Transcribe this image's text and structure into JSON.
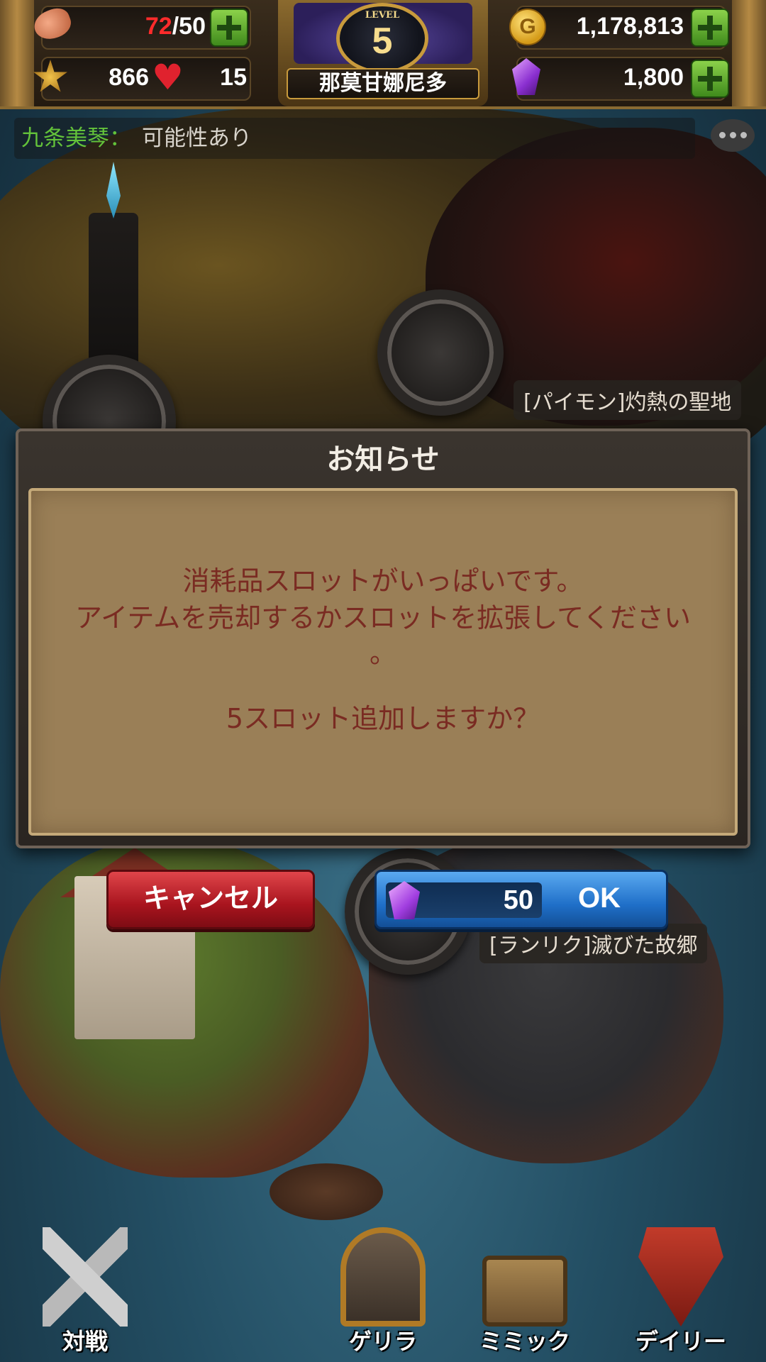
{
  "hud": {
    "stamina": {
      "current": "72",
      "separator": "/",
      "max": "50",
      "icon": "meat-icon"
    },
    "rank_points": {
      "value": "866",
      "icon": "medal-icon"
    },
    "hearts": {
      "value": "15",
      "icon": "heart-icon"
    },
    "level": {
      "word": "LEVEL",
      "number": "5"
    },
    "player_name": "那莫甘娜尼多",
    "gold": {
      "value": "1,178,813",
      "icon": "gold-coin-icon",
      "glyph": "G"
    },
    "gems": {
      "value": "1,800",
      "icon": "gem-icon"
    }
  },
  "chat": {
    "sender": "九条美琴：",
    "message": "可能性あり",
    "icon": "chat-bubble-icon"
  },
  "map": {
    "node_top": "[パイモン]灼熱の聖地",
    "node_bottom": "[ランリク]滅びた故郷"
  },
  "dialog": {
    "title": "お知らせ",
    "line1": "消耗品スロットがいっぱいです。",
    "line2": "アイテムを売却するかスロットを拡張してください",
    "line3": "。",
    "line4": "5スロット追加しますか？",
    "cancel_label": "キャンセル",
    "ok_label": "OK",
    "ok_cost": "50"
  },
  "nav": {
    "items": [
      {
        "label": "対戦",
        "icon": "crossed-swords-icon"
      },
      {
        "label": "ゲリラ",
        "icon": "gate-icon"
      },
      {
        "label": "ミミック",
        "icon": "treasure-chest-icon"
      },
      {
        "label": "デイリー",
        "icon": "winged-shield-icon"
      }
    ]
  },
  "colors": {
    "stamina_current": "#ff2b2b",
    "chat_sender": "#63c23a",
    "dialog_text": "#7a2b22",
    "cancel_button": "#b3161f",
    "ok_button": "#1f6fc8"
  }
}
